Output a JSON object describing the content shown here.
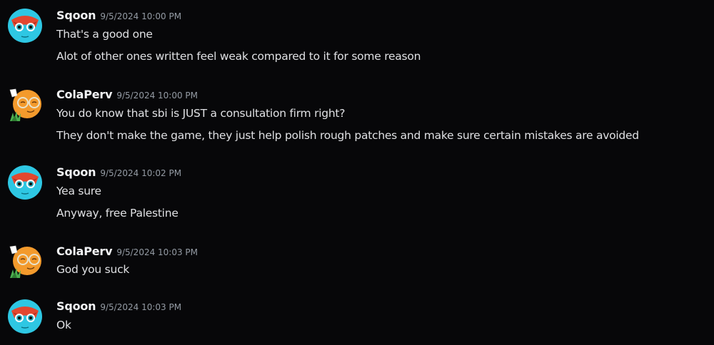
{
  "messages": [
    {
      "author": "Sqoon",
      "timestamp": "9/5/2024 10:00 PM",
      "avatar_icon": "sqoon-avatar-icon",
      "lines": [
        "That's a good one",
        "Alot of other ones written feel weak compared to it for some reason"
      ]
    },
    {
      "author": "ColaPerv",
      "timestamp": "9/5/2024 10:00 PM",
      "avatar_icon": "colaperv-avatar-icon",
      "lines": [
        "You do know that sbi is JUST a consultation firm right?",
        "They don't make the game, they just help polish rough patches and make sure certain mistakes are avoided"
      ]
    },
    {
      "author": "Sqoon",
      "timestamp": "9/5/2024 10:02 PM",
      "avatar_icon": "sqoon-avatar-icon",
      "lines": [
        "Yea sure",
        "Anyway, free Palestine"
      ]
    },
    {
      "author": "ColaPerv",
      "timestamp": "9/5/2024 10:03 PM",
      "avatar_icon": "colaperv-avatar-icon",
      "lines": [
        "God you suck"
      ]
    },
    {
      "author": "Sqoon",
      "timestamp": "9/5/2024 10:03 PM",
      "avatar_icon": "sqoon-avatar-icon",
      "lines": [
        "Ok"
      ]
    }
  ],
  "colors": {
    "background": "#070709",
    "username": "#f2f3f5",
    "timestamp": "#949ba4",
    "message_text": "#dfe0e3"
  }
}
